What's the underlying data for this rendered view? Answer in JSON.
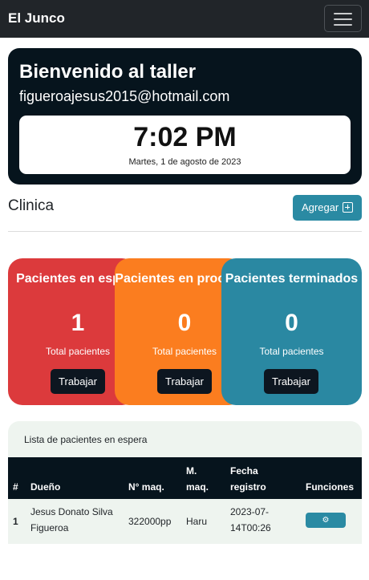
{
  "navbar": {
    "brand": "El Junco",
    "menu_icon": "hamburger-icon"
  },
  "welcome": {
    "title": "Bienvenido al taller",
    "email": "figueroajesus2015@hotmail.com",
    "time": "7:02 PM",
    "date": "Martes, 1 de agosto de 2023"
  },
  "clinic": {
    "title": "Clinica",
    "add_label": "Agregar",
    "add_icon": "plus-square-icon"
  },
  "stats": [
    {
      "title": "Pacientes en espera",
      "count": "1",
      "subtitle": "Total pacientes",
      "button": "Trabajar",
      "color": "#dc3a3c"
    },
    {
      "title": "Pacientes en procesos",
      "count": "0",
      "subtitle": "Total pacientes",
      "button": "Trabajar",
      "color": "#fb7d1f"
    },
    {
      "title": "Pacientes terminados",
      "count": "0",
      "subtitle": "Total pacientes",
      "button": "Trabajar",
      "color": "#2a88a2"
    }
  ],
  "patients": {
    "header": "Lista de pacientes en espera",
    "columns": [
      "#",
      "Dueño",
      "N° maq.",
      "M. maq.",
      "Fecha registro",
      "Funciones"
    ],
    "rows": [
      {
        "num": "1",
        "owner": "Jesus Donato Silva Figueroa",
        "maq": "322000pp",
        "mmaq": "Haru",
        "fecha": "2023-07-14T00:26",
        "action_icon": "gear-icon"
      }
    ]
  },
  "colors": {
    "navbar": "#212529",
    "card_dark": "#06141d",
    "accent": "#2a8aa3"
  }
}
